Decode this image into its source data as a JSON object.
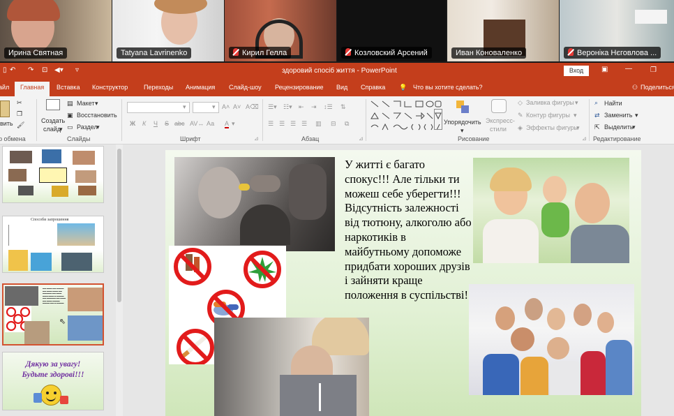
{
  "participants": [
    {
      "name": "Ирина Святная",
      "muted": false
    },
    {
      "name": "Tatyana Lavrinenko",
      "muted": false
    },
    {
      "name": "Кирил Гелла",
      "muted": true
    },
    {
      "name": "Козловский Арсений",
      "muted": true
    },
    {
      "name": "Иван Коноваленко",
      "muted": false
    },
    {
      "name": "Вероніка Нєговлова ...",
      "muted": true
    }
  ],
  "titlebar": {
    "doc_title": "здоровий спосіб життя - PowerPoint",
    "login": "Вход"
  },
  "tabs": [
    "айл",
    "Главная",
    "Вставка",
    "Конструктор",
    "Переходы",
    "Анимация",
    "Слайд-шоу",
    "Рецензирование",
    "Вид",
    "Справка",
    "Что вы хотите сделать?",
    "Поделиться"
  ],
  "ribbon": {
    "clipboard": {
      "paste": "вить",
      "label": "р обмена"
    },
    "slides": {
      "new_slide_1": "Создать",
      "new_slide_2": "слайд",
      "layout": "Макет",
      "reset": "Восстановить",
      "section": "Раздел",
      "label": "Слайды"
    },
    "font": {
      "label": "Шрифт",
      "bold": "Ж",
      "italic": "К",
      "underline": "Ч",
      "strike": "S",
      "abc": "abc",
      "aa": "Аа"
    },
    "paragraph": {
      "label": "Абзац"
    },
    "drawing": {
      "arrange": "Упорядочить",
      "styles_1": "Экспресс-",
      "styles_2": "стили",
      "fill": "Заливка фигуры",
      "outline": "Контур фигуры",
      "effects": "Эффекты фигуры",
      "label": "Рисование"
    },
    "editing": {
      "find": "Найти",
      "replace": "Заменить",
      "select": "Выделить",
      "label": "Редактирование"
    }
  },
  "thumbnails": {
    "t2_title": "Способи запрошення",
    "t4_line1": "Дякую за увагу!",
    "t4_line2": "Будьте здорові!!!"
  },
  "slide": {
    "text": "У житті є багато спокус!!! Але тільки ти можеш себе уберегти!!! Відсутність залежності від тютюну, алкоголю або наркотиків в майбутньому допоможе придбати хороших друзів і зайняти краще положення в суспільстві!"
  },
  "colors": {
    "ppt_accent": "#c43e1c",
    "selected_thumb": "#d35230",
    "ban_red": "#e21b1b"
  }
}
